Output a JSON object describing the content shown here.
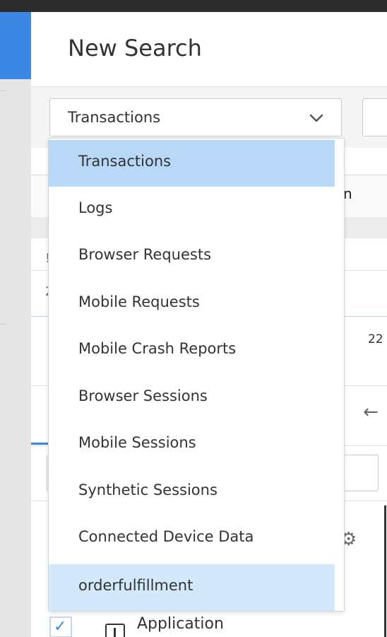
{
  "page": {
    "title": "New Search"
  },
  "search_type": {
    "selected": "Transactions",
    "options": [
      "Transactions",
      "Logs",
      "Browser Requests",
      "Mobile Requests",
      "Mobile Crash Reports",
      "Browser Sessions",
      "Mobile Sessions",
      "Synthetic Sessions",
      "Connected Device Data",
      "orderfulfillment"
    ],
    "highlighted": "orderfulfillment"
  },
  "background": {
    "header_fragment": "n",
    "row_marker_1": "!",
    "row_marker_2": "2",
    "row_number": "22",
    "back_arrow": "←",
    "gear": "⚙",
    "checkbox_tick": "✓",
    "field_label": "Application"
  },
  "icons": {
    "dropdown": "chevron-down-icon",
    "back": "arrow-left-icon",
    "settings": "gear-icon",
    "field_type": "info-box-icon"
  },
  "colors": {
    "accent": "#3d87e4",
    "selected_option": "#b9d8f7",
    "hovered_option": "#d4e8fb",
    "top_bar": "#2b2b2b"
  }
}
